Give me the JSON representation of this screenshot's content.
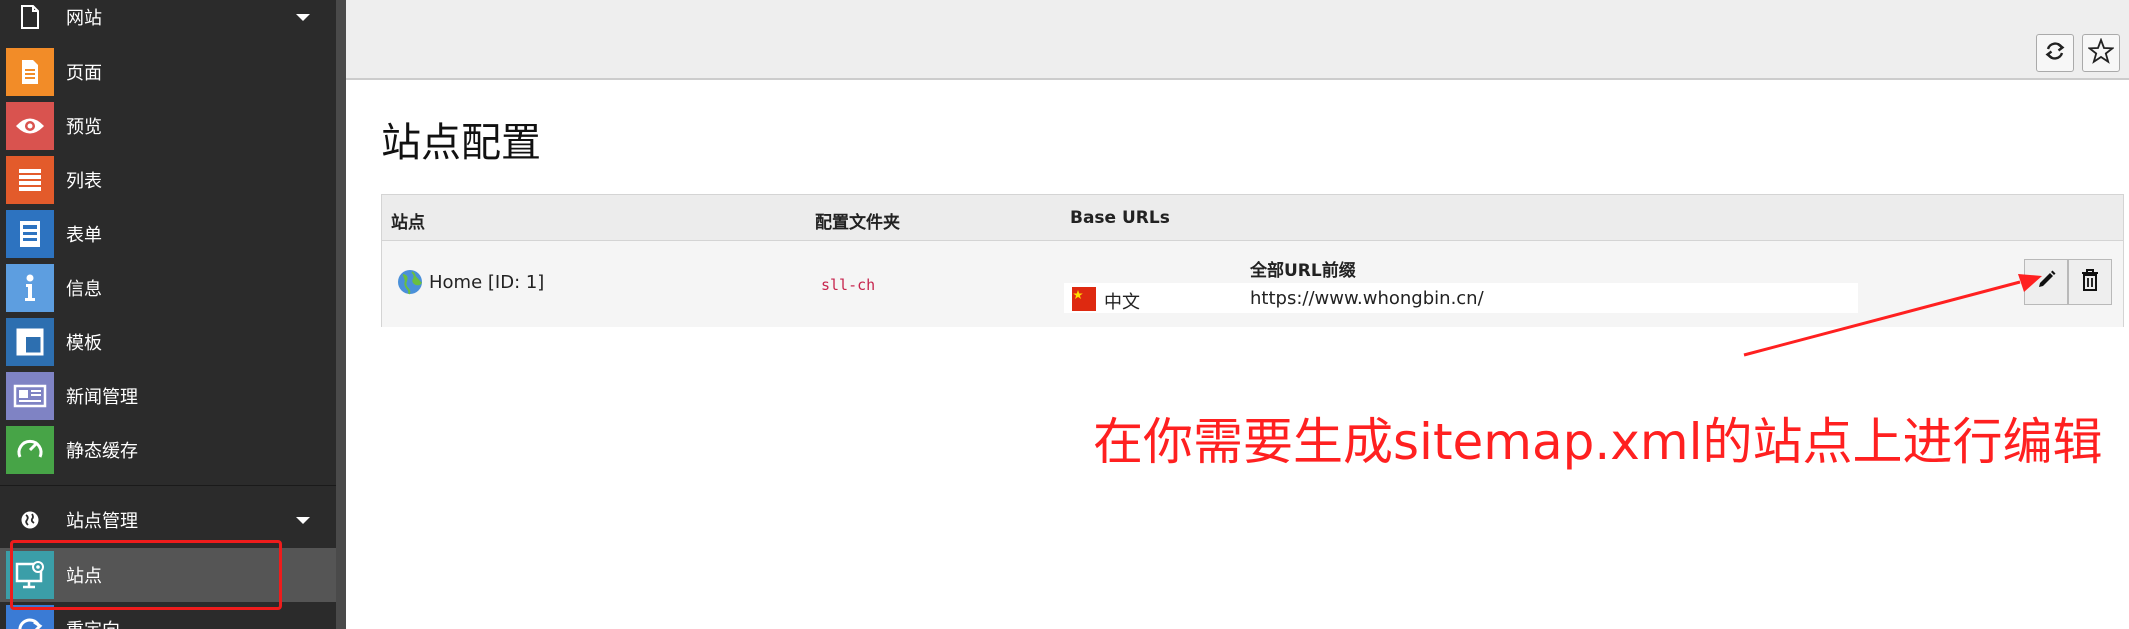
{
  "sidebar": {
    "website_group": {
      "label": "网站"
    },
    "website_items": [
      {
        "label": "页面",
        "icon": "page-icon",
        "color": "#f28c28"
      },
      {
        "label": "预览",
        "icon": "eye-icon",
        "color": "#d9534f"
      },
      {
        "label": "列表",
        "icon": "list-icon",
        "color": "#e35b2b"
      },
      {
        "label": "表单",
        "icon": "form-icon",
        "color": "#2d73c0"
      },
      {
        "label": "信息",
        "icon": "info-icon",
        "color": "#5d9ee0"
      },
      {
        "label": "模板",
        "icon": "template-icon",
        "color": "#2d6fb0"
      },
      {
        "label": "新闻管理",
        "icon": "news-icon",
        "color": "#7f83c4"
      },
      {
        "label": "静态缓存",
        "icon": "cache-icon",
        "color": "#47a447"
      }
    ],
    "site_group": {
      "label": "站点管理"
    },
    "site_items": [
      {
        "label": "站点",
        "icon": "site-icon",
        "color": "#3b9ea8"
      },
      {
        "label": "重定向",
        "icon": "redirect-icon",
        "color": "#3a7bd5"
      }
    ]
  },
  "toolbar": {
    "reload_icon": "reload-icon",
    "bookmark_icon": "star-icon"
  },
  "page": {
    "title": "站点配置"
  },
  "table": {
    "headers": {
      "site": "站点",
      "config_folder": "配置文件夹",
      "base_urls": "Base URLs"
    },
    "row": {
      "site_name": "Home [ID: 1]",
      "config_folder": "sll-ch",
      "prefix_header": "全部URL前缀",
      "language": "中文",
      "url": "https://www.whongbin.cn/"
    }
  },
  "annotation": {
    "text": "在你需要生成sitemap.xml的站点上进行编辑",
    "color": "#ff2020"
  }
}
